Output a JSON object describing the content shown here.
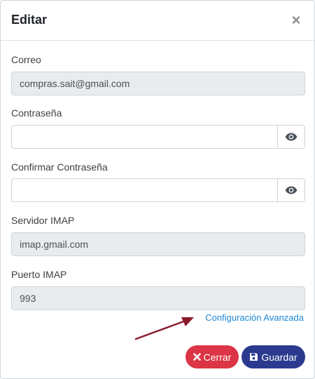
{
  "modal": {
    "title": "Editar",
    "close_symbol": "×"
  },
  "form": {
    "correo": {
      "label": "Correo",
      "value": "compras.sait@gmail.com"
    },
    "contrasena": {
      "label": "Contraseña",
      "value": ""
    },
    "confirmar": {
      "label": "Confirmar Contraseña",
      "value": ""
    },
    "servidor": {
      "label": "Servidor IMAP",
      "value": "imap.gmail.com"
    },
    "puerto": {
      "label": "Puerto IMAP",
      "value": "993"
    }
  },
  "advanced_link": "Configuración Avanzada",
  "buttons": {
    "cerrar": "Cerrar",
    "guardar": "Guardar"
  },
  "icons": {
    "eye": "eye-icon",
    "close": "times-icon",
    "save": "floppy-disk-icon",
    "annotation": "arrow-icon"
  },
  "colors": {
    "danger": "#dc3545",
    "primary": "#2b3a8f",
    "link": "#1e88d6",
    "readonly_bg": "#e9ecef",
    "arrow": "#8b1a2b"
  }
}
